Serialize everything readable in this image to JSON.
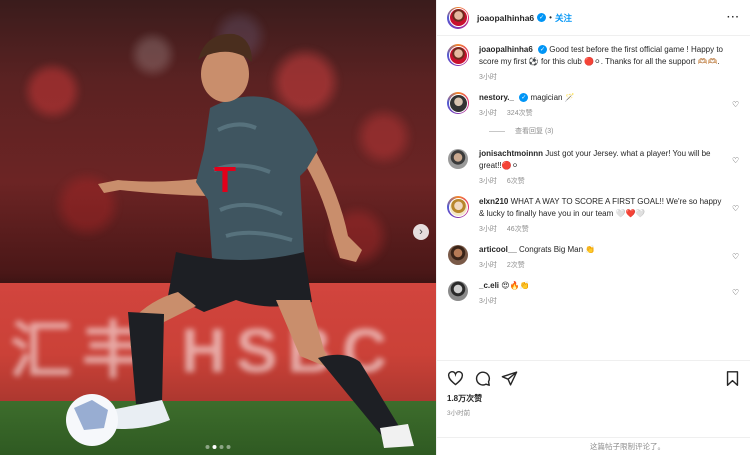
{
  "post": {
    "author": "joaopalhinha6",
    "follow_label": "关注",
    "more_icon": "more-horizontal-icon",
    "carousel": {
      "slide_count": 4,
      "active_index": 1
    }
  },
  "caption": {
    "username": "joaopalhinha6",
    "text": "Good test before the first official game ! Happy to score my first ⚽ for this club 🔴⚪. Thanks for all the support 🫶🏼🫶🏼.",
    "time": "3小时"
  },
  "comments": [
    {
      "username": "nestory._",
      "verified": true,
      "text": "magician 🪄",
      "time": "3小时",
      "likes": "324次赞",
      "view_replies": "查看回复 (3)"
    },
    {
      "username": "jonisachtmoinnn",
      "verified": false,
      "text": "Just got your Jersey. what a player! You will be great!!🔴⚪",
      "time": "3小时",
      "likes": "6次赞"
    },
    {
      "username": "elxn210",
      "verified": false,
      "text": "WHAT A WAY TO SCORE A FIRST GOAL!! We're so happy & lucky to finally have you in our team 🤍❤️🤍",
      "time": "3小时",
      "likes": "46次赞"
    },
    {
      "username": "articool__",
      "verified": false,
      "text": "Congrats Big Man 👏",
      "time": "3小时",
      "likes": "2次赞"
    },
    {
      "username": "_c.eli",
      "verified": false,
      "text": "😍🔥👏",
      "time": "3小时",
      "likes": ""
    }
  ],
  "actions": {
    "like_count": "1.8万次赞",
    "posted_time": "3小时前",
    "comments_limited": "这篇帖子限制评论了。"
  },
  "photo": {
    "banner_text": "汇丰 HSBC",
    "jersey_letter": "T"
  },
  "colors": {
    "link_blue": "#0095f6",
    "verified_blue": "#0095f6",
    "muted_gray": "#8e8e8e",
    "text_dark": "#262626"
  }
}
